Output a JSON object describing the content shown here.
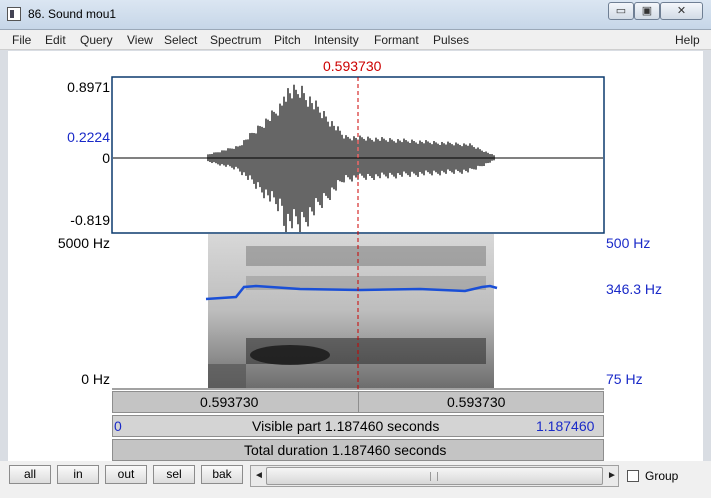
{
  "window": {
    "title": "86. Sound mou1",
    "min_glyph": "▭",
    "max_glyph": "▣",
    "close_glyph": "✕"
  },
  "menu": [
    "File",
    "Edit",
    "Query",
    "View",
    "Select",
    "Spectrum",
    "Pitch",
    "Intensity",
    "Formant",
    "Pulses",
    "Help"
  ],
  "waveform": {
    "cursor_time": "0.593730",
    "y_max": "0.8971",
    "y_cursor": "0.2224",
    "y_zero": "0",
    "y_min": "-0.819"
  },
  "spectrogram": {
    "freq_max": "5000 Hz",
    "freq_min": "0 Hz",
    "pitch_max": "500 Hz",
    "pitch_current": "346.3 Hz",
    "pitch_min": "75 Hz"
  },
  "time_bars": {
    "left_time": "0.593730",
    "right_time": "0.593730",
    "visible_start": "0",
    "visible_label": "Visible part 1.187460 seconds",
    "visible_end": "1.187460",
    "total_label": "Total duration 1.187460 seconds"
  },
  "buttons": {
    "all": "all",
    "in": "in",
    "out": "out",
    "sel": "sel",
    "bak": "bak"
  },
  "scroll": {
    "left_arrow": "◄",
    "right_arrow": "►"
  },
  "group_label": "Group",
  "colors": {
    "cursor": "#cc0000",
    "pitch_line": "#1a4fd6",
    "axis_blue": "#1a2ac8"
  }
}
